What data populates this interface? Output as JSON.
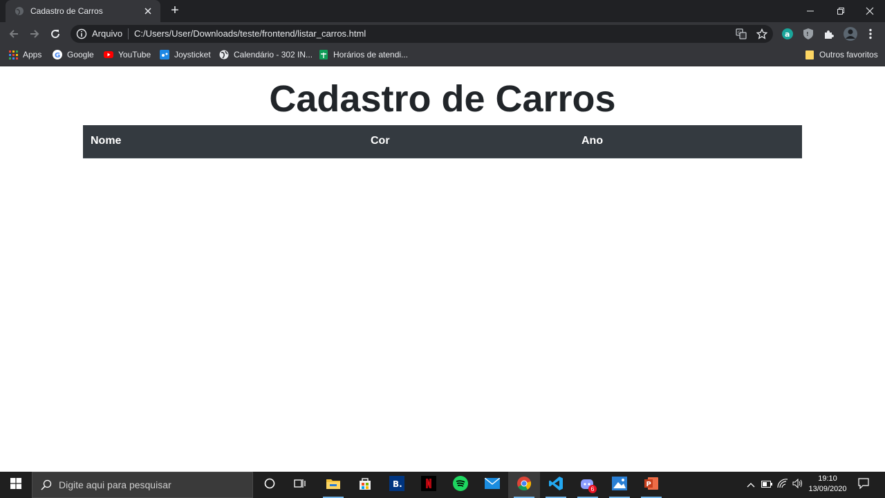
{
  "browser": {
    "tab_title": "Cadastro de Carros",
    "new_tab_label": "+",
    "address": {
      "security_label": "Arquivo",
      "url": "C:/Users/User/Downloads/teste/frontend/listar_carros.html"
    },
    "bookmarks": [
      {
        "label": "Apps",
        "icon": "apps-grid-icon"
      },
      {
        "label": "Google",
        "icon": "google-icon"
      },
      {
        "label": "YouTube",
        "icon": "youtube-icon"
      },
      {
        "label": "Joysticket",
        "icon": "joysticket-icon"
      },
      {
        "label": "Calendário - 302 IN...",
        "icon": "globe-icon"
      },
      {
        "label": "Horários de atendi...",
        "icon": "sheets-icon"
      }
    ],
    "other_bookmarks": "Outros favoritos"
  },
  "page": {
    "title": "Cadastro de Carros",
    "table": {
      "columns": [
        "Nome",
        "Cor",
        "Ano"
      ],
      "rows": []
    }
  },
  "taskbar": {
    "search_placeholder": "Digite aqui para pesquisar",
    "apps": [
      "cortana-icon",
      "task-view-icon",
      "file-explorer-icon",
      "store-icon",
      "booking-icon",
      "netflix-icon",
      "spotify-icon",
      "mail-icon",
      "chrome-icon",
      "vscode-icon",
      "discord-icon",
      "photos-icon",
      "powerpoint-icon"
    ],
    "notification_badge": "6",
    "time": "19:10",
    "date": "13/09/2020"
  },
  "colors": {
    "table_header_bg": "#343a40",
    "browser_dark": "#202124",
    "browser_toolbar": "#35363a",
    "taskbar": "#1f1f1f"
  }
}
